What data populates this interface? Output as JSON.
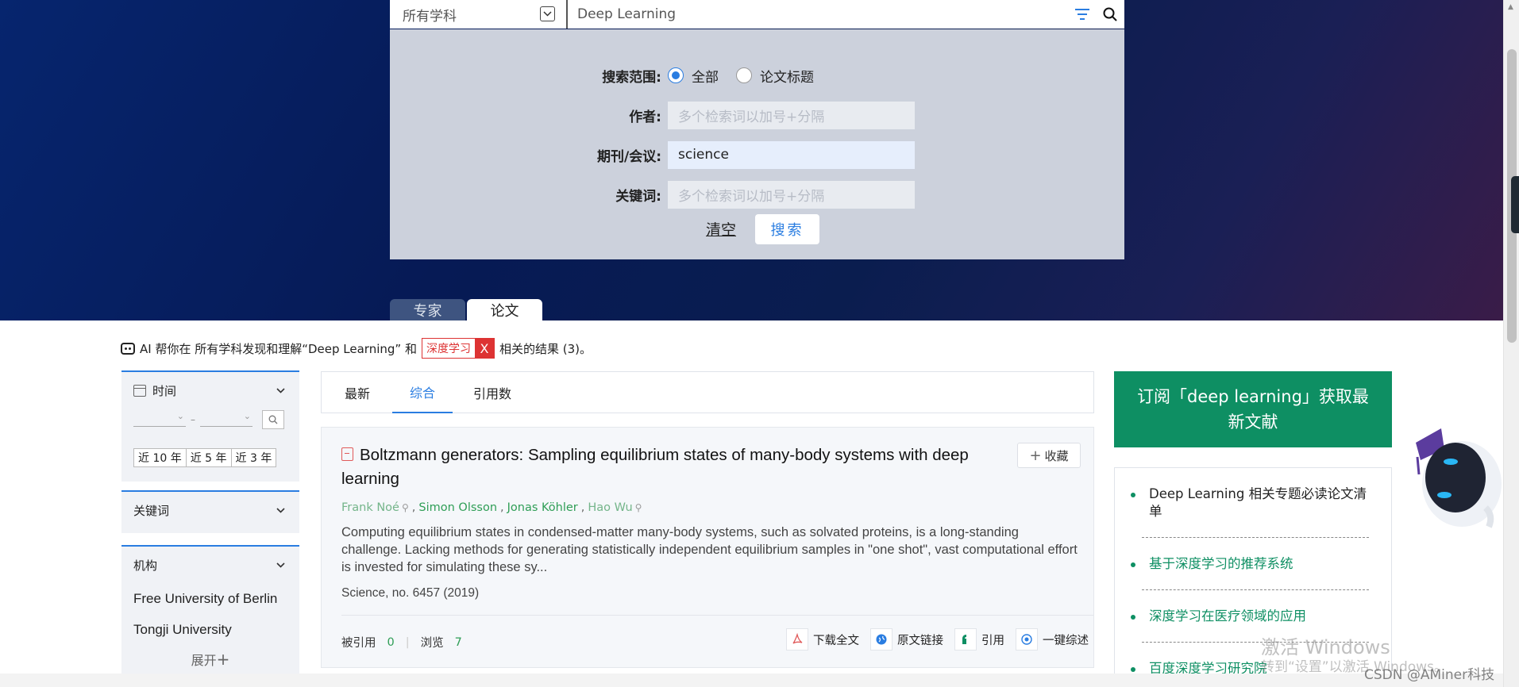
{
  "search": {
    "subject": "所有学科",
    "query": "Deep Learning"
  },
  "advanced": {
    "scope_label": "搜索范围:",
    "scope_options": [
      "全部",
      "论文标题"
    ],
    "scope_selected": "全部",
    "author_label": "作者:",
    "author_placeholder": "多个检索词以加号+分隔",
    "venue_label": "期刊/会议:",
    "venue_value": "science",
    "keyword_label": "关键词:",
    "keyword_placeholder": "多个检索词以加号+分隔",
    "clear_label": "清空",
    "search_label": "搜索"
  },
  "tabs": {
    "expert": "专家",
    "paper": "论文"
  },
  "ai_line": {
    "prefix": "AI 帮你在 所有学科发现和理解“Deep Learning” 和",
    "tag": "深度学习",
    "tag_close": "X",
    "suffix": "相关的结果 (3)。"
  },
  "facets": {
    "time_label": "时间",
    "year_dash": "–",
    "quick_years": [
      "近 10 年",
      "近 5 年",
      "近 3 年"
    ],
    "keywords_label": "关键词",
    "org_label": "机构",
    "orgs": [
      "Free University of Berlin",
      "Tongji University"
    ],
    "expand_label": "展开",
    "expand_icon": "+"
  },
  "sort": {
    "tabs": [
      "最新",
      "综合",
      "引用数"
    ],
    "active": "综合"
  },
  "paper": {
    "title": "Boltzmann generators: Sampling equilibrium states of many-body systems with deep learning",
    "collect_label": "收藏",
    "collect_icon": "+",
    "authors": [
      "Frank Noé",
      "Simon Olsson",
      "Jonas Köhler",
      "Hao Wu"
    ],
    "abstract": "Computing equilibrium states in condensed-matter many-body systems, such as solvated proteins, is a long-standing challenge. Lacking methods for generating statistically independent equilibrium samples in \"one shot\", vast computational effort is invested for simulating these sy...",
    "venue": "Science, no. 6457 (2019)",
    "cited_label": "被引用",
    "cited_count": "0",
    "views_label": "浏览",
    "views_count": "7",
    "actions": [
      "下载全文",
      "原文链接",
      "引用",
      "一键综述"
    ]
  },
  "subscribe": {
    "text": "订阅「deep learning」获取最新文献"
  },
  "topics": [
    "Deep Learning 相关专题必读论文清单",
    "基于深度学习的推荐系统",
    "深度学习在医疗领域的应用",
    "百度深度学习研究院"
  ],
  "watermarks": {
    "windows_title": "激活 Windows",
    "windows_sub": "转到“设置”以激活 Windows。",
    "csdn": "CSDN @AMiner科技"
  },
  "colors": {
    "accent_blue": "#2a7de1",
    "green": "#0e8f63",
    "author_green": "#2f9e56",
    "tag_red": "#dd3333"
  },
  "icons": [
    "chevron-down-icon",
    "filter-icon",
    "search-icon",
    "robot-icon",
    "calendar-icon",
    "pdf-icon",
    "download-icon",
    "link-icon",
    "quote-icon",
    "summary-icon"
  ]
}
